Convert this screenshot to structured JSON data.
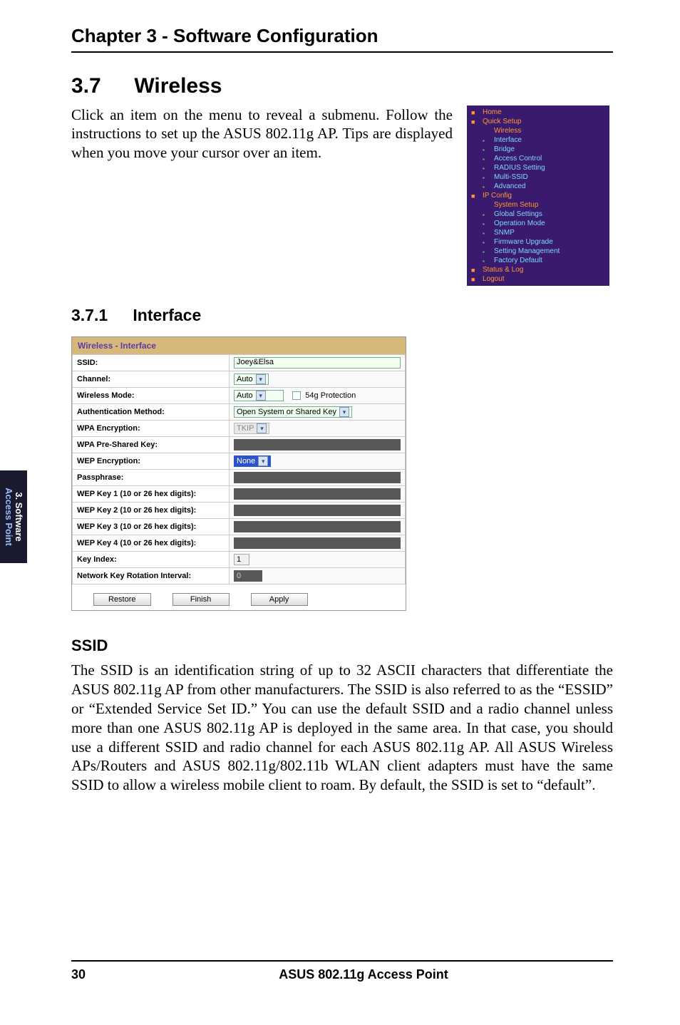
{
  "chapter": {
    "title": "Chapter 3 - Software Configuration"
  },
  "section": {
    "num": "3.7",
    "title": "Wireless"
  },
  "intro": "Click an item on the menu to reveal a submenu. Follow the instructions to set up the ASUS 802.11g AP. Tips are displayed when you move your cursor over an item.",
  "subsection": {
    "num": "3.7.1",
    "title": "Interface"
  },
  "form": {
    "header": "Wireless - Interface",
    "rows": {
      "ssid": {
        "label": "SSID:",
        "value": "Joey&Elsa"
      },
      "channel": {
        "label": "Channel:",
        "value": "Auto"
      },
      "mode": {
        "label": "Wireless Mode:",
        "value": "Auto",
        "opt_label": "54g Protection"
      },
      "auth": {
        "label": "Authentication Method:",
        "value": "Open System or Shared Key"
      },
      "wpa_enc": {
        "label": "WPA Encryption:",
        "value": "TKIP"
      },
      "wpa_psk": {
        "label": "WPA Pre-Shared Key:"
      },
      "wep_enc": {
        "label": "WEP Encryption:",
        "value": "None"
      },
      "pass": {
        "label": "Passphrase:"
      },
      "wep1": {
        "label": "WEP Key 1 (10 or 26 hex digits):"
      },
      "wep2": {
        "label": "WEP Key 2 (10 or 26 hex digits):"
      },
      "wep3": {
        "label": "WEP Key 3 (10 or 26 hex digits):"
      },
      "wep4": {
        "label": "WEP Key 4 (10 or 26 hex digits):"
      },
      "keyidx": {
        "label": "Key Index:",
        "value": "1"
      },
      "rot": {
        "label": "Network Key Rotation Interval:",
        "value": "0"
      }
    },
    "buttons": {
      "restore": "Restore",
      "finish": "Finish",
      "apply": "Apply"
    }
  },
  "nav": {
    "items": [
      {
        "level": "top",
        "label": "Home"
      },
      {
        "level": "top",
        "label": "Quick Setup"
      },
      {
        "level": "sub2",
        "label": "Wireless"
      },
      {
        "level": "sub",
        "label": "Interface"
      },
      {
        "level": "sub",
        "label": "Bridge"
      },
      {
        "level": "sub",
        "label": "Access Control"
      },
      {
        "level": "sub",
        "label": "RADIUS Setting"
      },
      {
        "level": "sub",
        "label": "Multi-SSID"
      },
      {
        "level": "sub",
        "label": "Advanced"
      },
      {
        "level": "top",
        "label": "IP Config"
      },
      {
        "level": "sub2",
        "label": "System Setup"
      },
      {
        "level": "sub",
        "label": "Global Settings"
      },
      {
        "level": "sub",
        "label": "Operation Mode"
      },
      {
        "level": "sub",
        "label": "SNMP"
      },
      {
        "level": "sub",
        "label": "Firmware Upgrade"
      },
      {
        "level": "sub",
        "label": "Setting Management"
      },
      {
        "level": "sub",
        "label": "Factory Default"
      },
      {
        "level": "top",
        "label": "Status & Log"
      },
      {
        "level": "top",
        "label": "Logout"
      }
    ]
  },
  "ssid": {
    "heading": "SSID",
    "paragraph": "The SSID is an identification string of up to 32 ASCII characters that differentiate the ASUS 802.11g AP from other manufacturers. The SSID is also referred to as the “ESSID” or “Extended Service Set ID.” You can use the default SSID and a radio channel unless more than one ASUS 802.11g AP is deployed in the same area. In that case, you should use a different SSID and radio channel for each ASUS 802.11g AP. All ASUS Wireless APs/Routers and ASUS 802.11g/802.11b WLAN client adapters must have the same SSID to allow a wireless mobile client to roam. By default, the SSID is set to “default”."
  },
  "sidetab": {
    "line1": "3. Software",
    "line2": "Access Point"
  },
  "footer": {
    "page": "30",
    "title": "ASUS 802.11g Access Point"
  }
}
